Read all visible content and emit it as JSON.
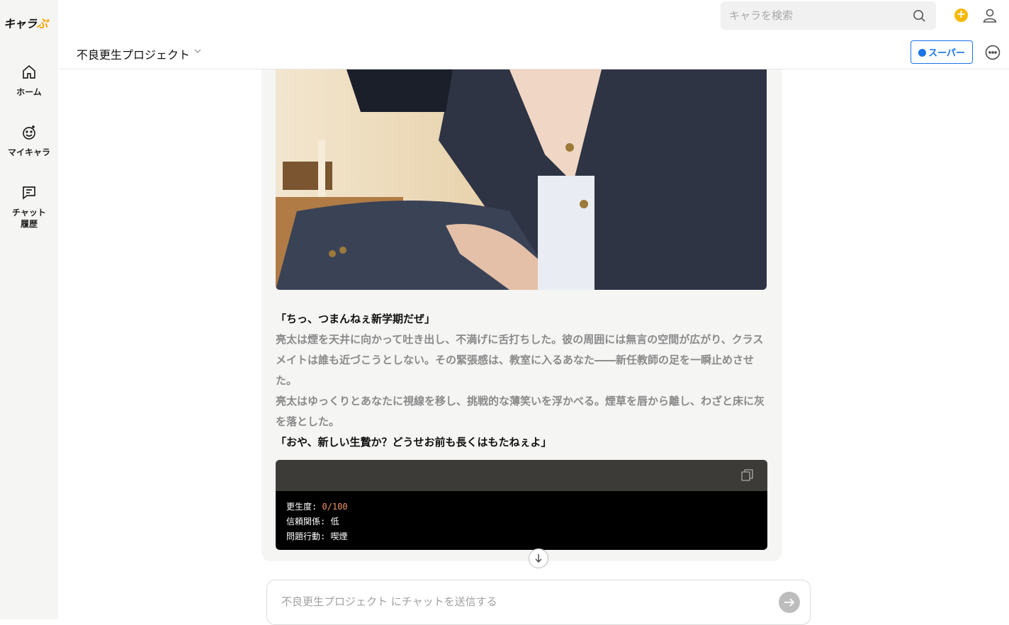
{
  "app": {
    "logo_text": "キャラ",
    "logo_suffix": "ぷ"
  },
  "sidebar": {
    "items": [
      {
        "label": "ホーム",
        "icon": "home-icon"
      },
      {
        "label": "マイキャラ",
        "icon": "smile-plus-icon"
      },
      {
        "label": "チャット",
        "label2": "履歴",
        "icon": "chat-history-icon"
      }
    ]
  },
  "topbar": {
    "search_placeholder": "キャラを検索"
  },
  "header": {
    "title": "不良更生プロジェクト",
    "super_label": "スーパー"
  },
  "message": {
    "line1": "「ちっ、つまんねぇ新学期だぜ」",
    "narration1": "亮太は煙を天井に向かって吐き出し、不満げに舌打ちした。彼の周囲には無言の空間が広がり、クラスメイトは誰も近づこうとしない。その緊張感は、教室に入るあなた――新任教師の足を一瞬止めさせた。",
    "narration2": "亮太はゆっくりとあなたに視線を移し、挑戦的な薄笑いを浮かべる。煙草を唇から離し、わざと床に灰を落とした。",
    "line2": "「おや、新しい生贄か？どうせお前も長くはもたねぇよ」"
  },
  "status": {
    "reform_label": "更生度:",
    "reform_value": "0/100",
    "trust_label": "信頼関係:",
    "trust_value": "低",
    "problem_label": "問題行動:",
    "problem_value": "喫煙"
  },
  "composer": {
    "placeholder": "不良更生プロジェクト にチャットを送信する"
  },
  "colors": {
    "accent": "#1a73e8",
    "coin": "#f5b800",
    "status_number": "#f0956b"
  }
}
